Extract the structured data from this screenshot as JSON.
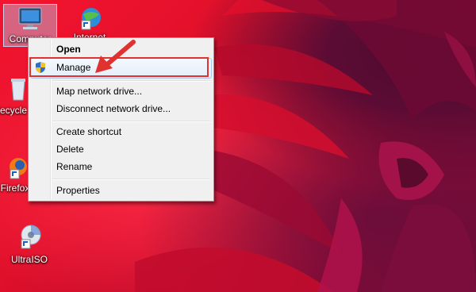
{
  "desktop": {
    "icons": [
      {
        "label": "Computer",
        "icon": "computer-icon"
      },
      {
        "label": "Internet",
        "icon": "internet-shortcut-icon"
      },
      {
        "label": "Recycle Bin",
        "icon": "recycle-bin-icon"
      },
      {
        "label": "Firefox",
        "icon": "firefox-shortcut-icon"
      },
      {
        "label": "UltraISO",
        "icon": "ultraiso-shortcut-icon"
      }
    ]
  },
  "context_menu": {
    "items": [
      {
        "label": "Open"
      },
      {
        "label": "Manage",
        "icon": "uac-shield-icon"
      },
      {
        "label": "Map network drive..."
      },
      {
        "label": "Disconnect network drive..."
      },
      {
        "label": "Create shortcut"
      },
      {
        "label": "Delete"
      },
      {
        "label": "Rename"
      },
      {
        "label": "Properties"
      }
    ]
  },
  "colors": {
    "annotation_red": "#e0332f",
    "menu_background": "#f0f0f0",
    "wallpaper_red": "#e0102a",
    "wallpaper_magenta": "#8e0b36"
  }
}
